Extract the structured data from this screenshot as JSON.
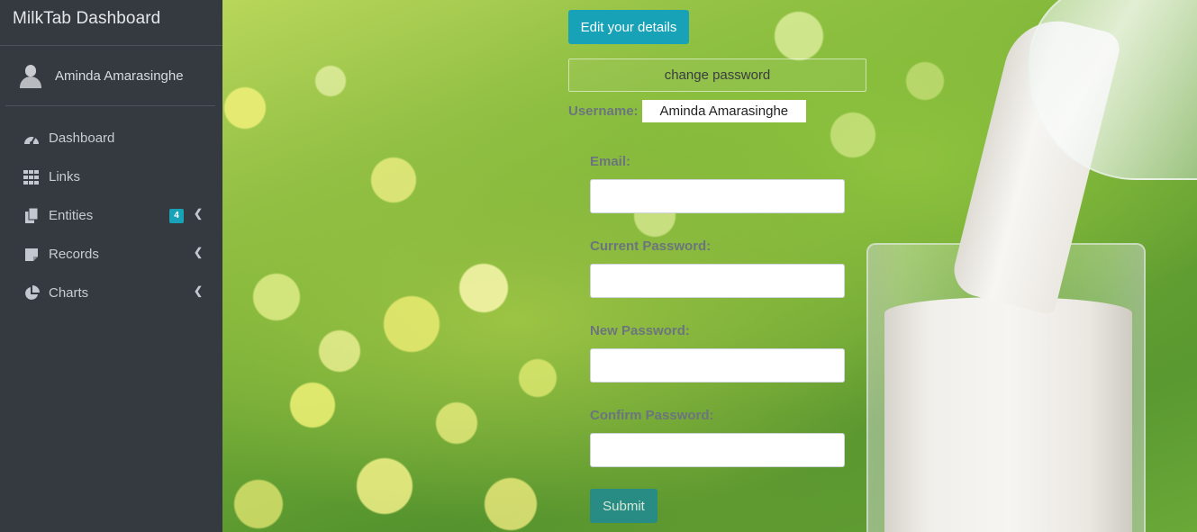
{
  "brand": {
    "title": "MilkTab Dashboard"
  },
  "user": {
    "name": "Aminda Amarasinghe"
  },
  "nav": [
    {
      "label": "Dashboard",
      "icon": "dashboard-icon"
    },
    {
      "label": "Links",
      "icon": "grid-icon"
    },
    {
      "label": "Entities",
      "icon": "copy-icon",
      "badge": "4"
    },
    {
      "label": "Records",
      "icon": "note-icon"
    },
    {
      "label": "Charts",
      "icon": "pie-chart-icon"
    }
  ],
  "form": {
    "edit_button": "Edit your details",
    "change_password": "change password",
    "username_label": "Username:",
    "username_value": "Aminda Amarasinghe",
    "email_label": "Email:",
    "email_value": "",
    "current_password_label": "Current Password:",
    "current_password_value": "",
    "new_password_label": "New Password:",
    "new_password_value": "",
    "confirm_password_label": "Confirm Password:",
    "confirm_password_value": "",
    "submit_label": "Submit"
  },
  "colors": {
    "sidebar_bg": "#343a40",
    "accent": "#17a2b8",
    "label_text": "#6c757d"
  }
}
